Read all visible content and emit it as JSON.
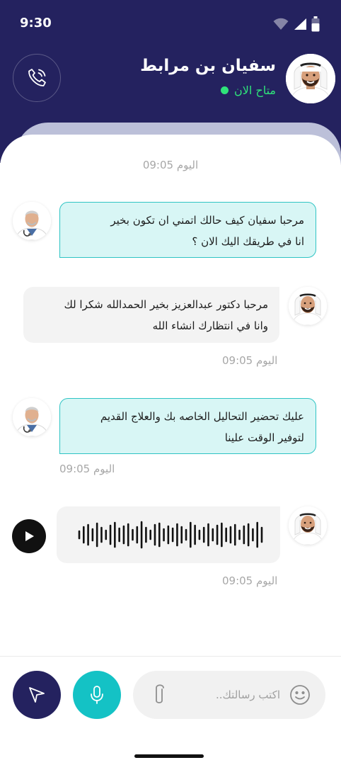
{
  "status_bar": {
    "time": "9:30"
  },
  "header": {
    "contact_name": "سفيان بن مرابط",
    "contact_status": "متاح الان"
  },
  "date_divider": "اليوم 09:05",
  "messages": [
    {
      "sender": "doctor",
      "lines": [
        "مرحبا سفيان كيف حالك اتمني ان تكون بخير",
        "انا في طريقك اليك الان ؟"
      ]
    },
    {
      "sender": "user",
      "lines": [
        "مرحبا دكتور عبدالعزيز بخير الحمدالله شكرا لك",
        "وانا في انتظارك انشاء الله"
      ],
      "time": "اليوم 09:05"
    },
    {
      "sender": "doctor",
      "lines": [
        "عليك تحضير التحاليل الخاصه بك والعلاج القديم",
        "لتوفير الوقت علينا"
      ],
      "time": "اليوم 09:05"
    },
    {
      "sender": "user",
      "type": "voice",
      "time": "اليوم 09:05"
    }
  ],
  "input": {
    "placeholder": "اكتب رسالتك.."
  },
  "colors": {
    "primary": "#24225f",
    "accent": "#14c2c5",
    "online": "#2fe37a",
    "doctor_bubble": "#d8f6f5"
  },
  "icons": [
    "phone-icon",
    "wifi-icon",
    "signal-icon",
    "battery-icon",
    "play-icon",
    "waveform-icon",
    "send-icon",
    "mic-icon",
    "attach-icon",
    "emoji-icon"
  ]
}
